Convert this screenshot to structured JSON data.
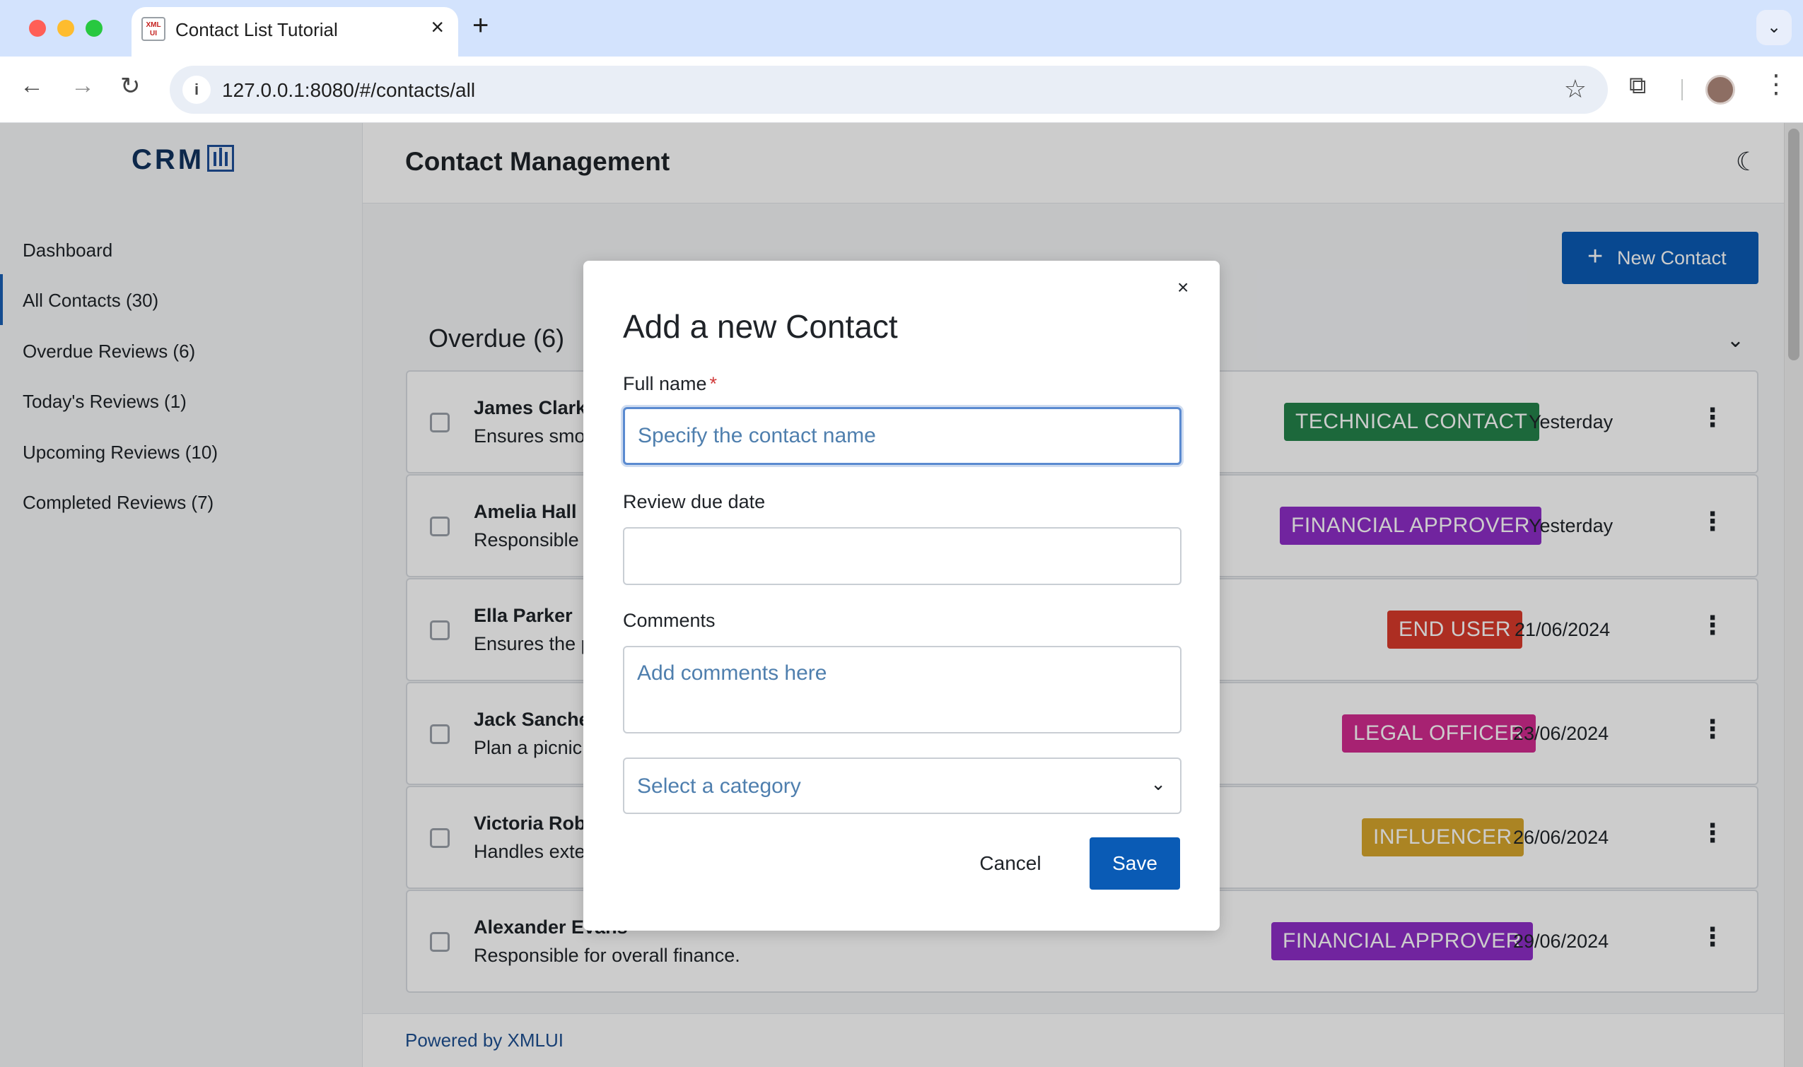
{
  "browser": {
    "tab_title": "Contact List Tutorial",
    "favicon_text": "XML UI",
    "url": "127.0.0.1:8080/#/contacts/all"
  },
  "sidebar": {
    "logo_text": "CRM",
    "items": [
      {
        "label": "Dashboard",
        "active": false
      },
      {
        "label": "All Contacts (30)",
        "active": true
      },
      {
        "label": "Overdue Reviews (6)",
        "active": false
      },
      {
        "label": "Today's Reviews (1)",
        "active": false
      },
      {
        "label": "Upcoming Reviews (10)",
        "active": false
      },
      {
        "label": "Completed Reviews (7)",
        "active": false
      }
    ]
  },
  "header": {
    "title": "Contact Management"
  },
  "toolbar": {
    "new_contact_label": "New Contact"
  },
  "section": {
    "title": "Overdue (6)"
  },
  "contacts": [
    {
      "name": "James Clark",
      "desc": "Ensures smo",
      "badge": "TECHNICAL CONTACT",
      "badge_color": "#23834a",
      "date": "Yesterday"
    },
    {
      "name": "Amelia Hall",
      "desc": "Responsible",
      "badge": "FINANCIAL APPROVER",
      "badge_color": "#8e2ec7",
      "date": "Yesterday"
    },
    {
      "name": "Ella Parker",
      "desc": "Ensures the p",
      "badge": "END USER",
      "badge_color": "#d93a2b",
      "date": "21/06/2024"
    },
    {
      "name": "Jack Sanche",
      "desc": "Plan a picnic",
      "badge": "LEGAL OFFICER",
      "badge_color": "#d12b8f",
      "date": "23/06/2024"
    },
    {
      "name": "Victoria Rob",
      "desc": "Handles exte",
      "badge": "INFLUENCER",
      "badge_color": "#d6a52c",
      "date": "26/06/2024"
    },
    {
      "name": "Alexander Evans",
      "desc": "Responsible for overall finance.",
      "badge": "FINANCIAL APPROVER",
      "badge_color": "#8e2ec7",
      "date": "29/06/2024"
    }
  ],
  "footer": {
    "text": "Powered by XMLUI"
  },
  "modal": {
    "title": "Add a new Contact",
    "close_glyph": "×",
    "full_name_label": "Full name",
    "required_mark": "*",
    "full_name_placeholder": "Specify the contact name",
    "full_name_value": "",
    "review_date_label": "Review due date",
    "review_date_value": "",
    "comments_label": "Comments",
    "comments_placeholder": "Add comments here",
    "category_placeholder": "Select a category",
    "cancel_label": "Cancel",
    "save_label": "Save"
  },
  "colors": {
    "primary": "#0a5bb5",
    "link": "#1d4f91"
  }
}
